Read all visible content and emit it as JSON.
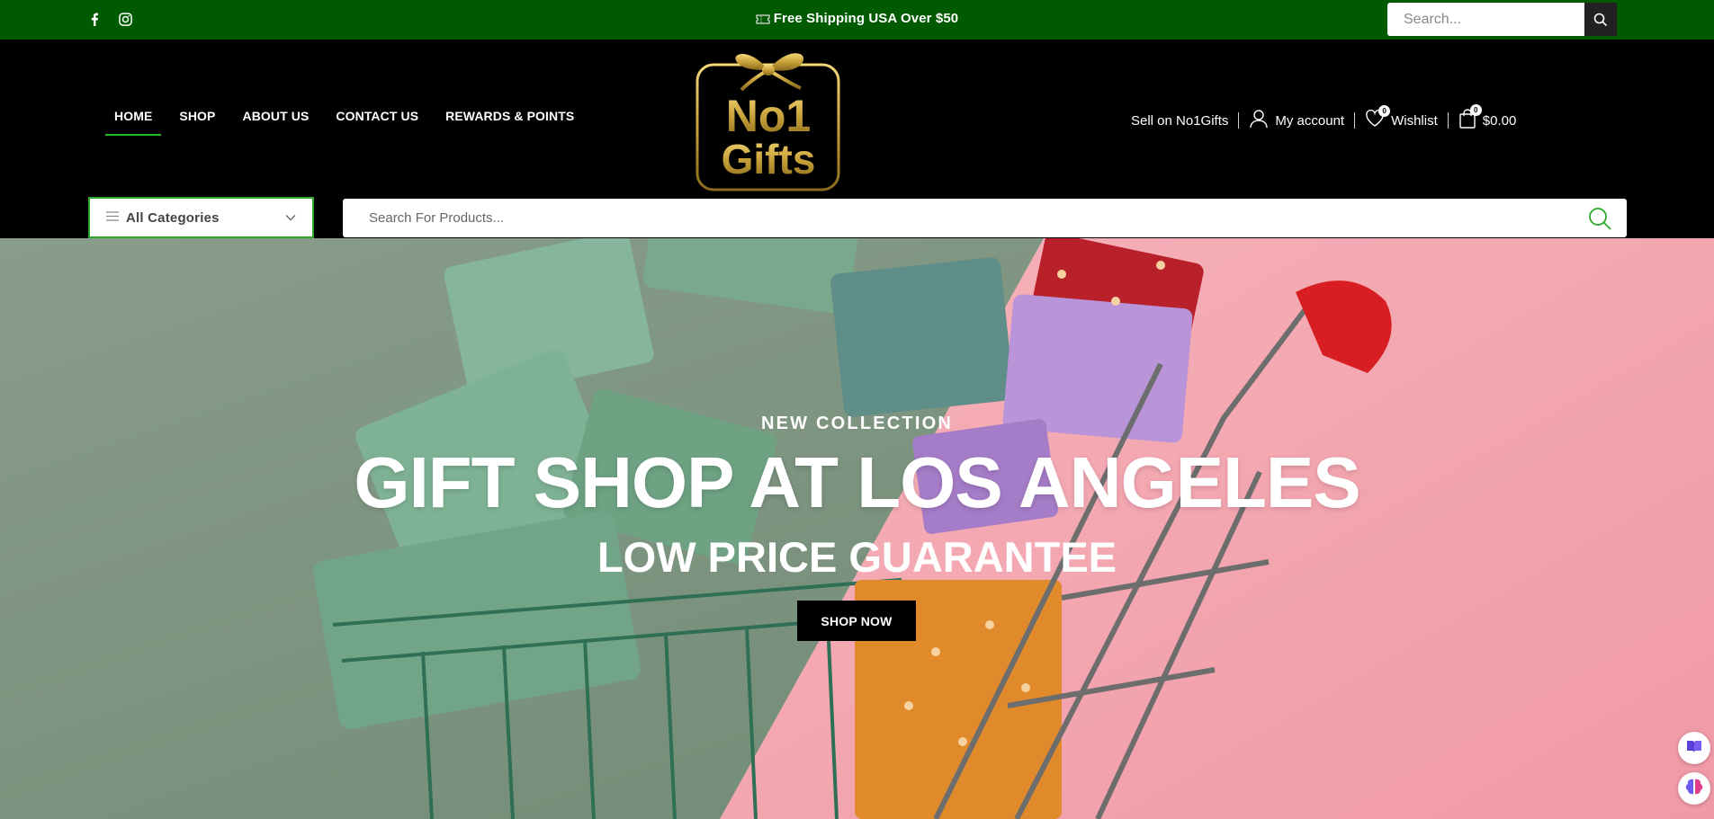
{
  "topbar": {
    "promo_text": "Free Shipping USA Over $50",
    "search_placeholder": "Search...",
    "bg_color": "#005a00",
    "social": [
      "facebook-icon",
      "instagram-icon"
    ]
  },
  "nav": {
    "items": [
      {
        "label": "HOME",
        "active": true
      },
      {
        "label": "SHOP"
      },
      {
        "label": "ABOUT US"
      },
      {
        "label": "CONTACT US"
      },
      {
        "label": "REWARDS & POINTS"
      }
    ],
    "active_color": "#1fb81f"
  },
  "logo": {
    "line1": "No1",
    "line2": "Gifts",
    "gold": "#c9a23a"
  },
  "header_right": {
    "sell_label": "Sell on No1Gifts",
    "account_label": "My account",
    "wishlist_label": "Wishlist",
    "wishlist_count": "0",
    "cart_count": "0",
    "cart_total": "$0.00"
  },
  "categories": {
    "label": "All Categories",
    "border_color": "#2ea62e"
  },
  "product_search": {
    "placeholder": "Search For Products..."
  },
  "hero": {
    "eyebrow": "NEW COLLECTION",
    "headline": "GIFT SHOP AT LOS ANGELES",
    "subline": "LOW PRICE GUARANTEE",
    "cta": "SHOP NOW",
    "left_bg": "#7d9380",
    "right_bg": "#f2a7b0"
  }
}
